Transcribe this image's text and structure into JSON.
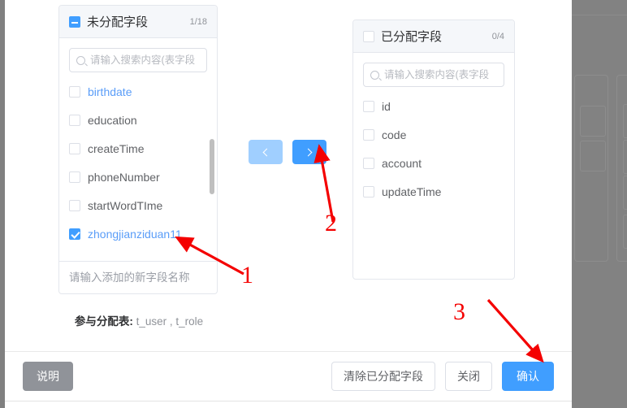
{
  "modal": {
    "left_panel": {
      "title": "未分配字段",
      "count": "1/18",
      "header_checkbox_state": "indeterminate",
      "search_placeholder": "请输入搜索内容(表字段",
      "items": [
        {
          "label": "birthdate",
          "checked": false,
          "accent": true
        },
        {
          "label": "education",
          "checked": false,
          "accent": false
        },
        {
          "label": "createTime",
          "checked": false,
          "accent": false
        },
        {
          "label": "phoneNumber",
          "checked": false,
          "accent": false
        },
        {
          "label": "startWordTIme",
          "checked": false,
          "accent": false
        },
        {
          "label": "zhongjianziduan11",
          "checked": true,
          "accent": true
        }
      ],
      "footer_placeholder": "请输入添加的新字段名称"
    },
    "right_panel": {
      "title": "已分配字段",
      "count": "0/4",
      "header_checkbox_state": "unchecked",
      "search_placeholder": "请输入搜索内容(表字段",
      "items": [
        {
          "label": "id",
          "checked": false
        },
        {
          "label": "code",
          "checked": false
        },
        {
          "label": "account",
          "checked": false
        },
        {
          "label": "updateTime",
          "checked": false
        }
      ]
    },
    "transfer": {
      "to_left_label": "‹",
      "to_right_label": "›"
    },
    "tables_line": {
      "label": "参与分配表:",
      "value": "t_user , t_role"
    },
    "footer": {
      "help_label": "说明",
      "clear_label": "清除已分配字段",
      "close_label": "关闭",
      "confirm_label": "确认"
    }
  },
  "annotations": [
    {
      "id": "anno-1",
      "text": "1"
    },
    {
      "id": "anno-2",
      "text": "2"
    },
    {
      "id": "anno-3",
      "text": "3"
    }
  ],
  "colors": {
    "primary": "#409eff",
    "primary_light": "#a0cfff",
    "accent_text": "#5a9df8",
    "annotation": "#f40000",
    "grey_button": "#909399"
  }
}
